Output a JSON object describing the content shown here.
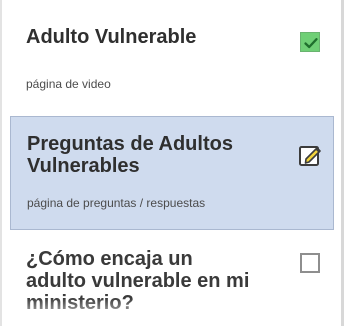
{
  "items": [
    {
      "title": "Adulto Vulnerable",
      "subtitle": "página de video",
      "status_icon": "check-icon"
    },
    {
      "title": "Preguntas de Adultos Vulnerables",
      "subtitle": "página de preguntas / respuestas",
      "status_icon": "edit-icon"
    },
    {
      "title": "¿Cómo encaja un adulto vulnerable en mi ministerio?",
      "status_icon": "empty-checkbox-icon"
    }
  ],
  "colors": {
    "selected_background": "#cfdbee",
    "check_green": "#6fcf76",
    "edit_yellow": "#f2d43c"
  }
}
